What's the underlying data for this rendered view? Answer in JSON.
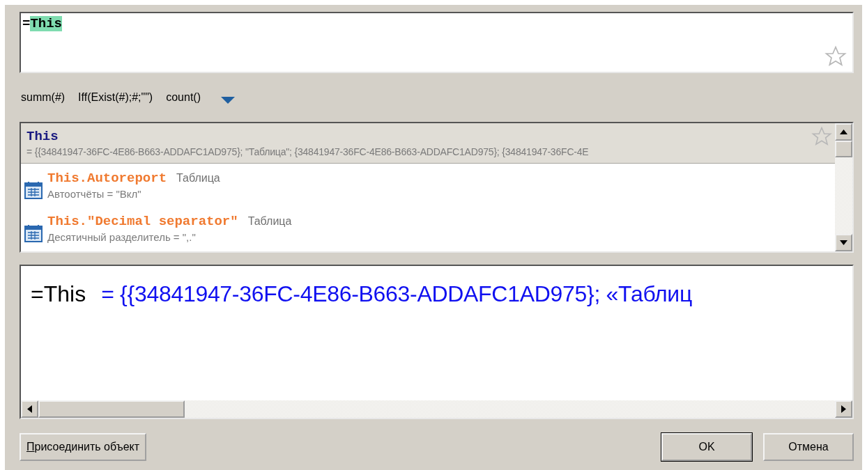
{
  "editor": {
    "prefix": "=",
    "value": "This"
  },
  "quick_functions": [
    "summ(#)",
    "Iff(Exist(#);#;\"\")",
    "count()"
  ],
  "suggestions": [
    {
      "name": "This",
      "description": "= {{34841947-36FC-4E86-B663-ADDAFC1AD975}; \"Таблица\"; {34841947-36FC-4E86-B663-ADDAFC1AD975}; {34841947-36FC-4E",
      "selected": true
    },
    {
      "name": "This.Autoreport",
      "type": "Таблица",
      "description": "Автоотчёты = \"Вкл\"",
      "selected": false
    },
    {
      "name": "This.\"Decimal separator\"",
      "type": "Таблица",
      "description": "Десятичный разделитель = \",.\"",
      "selected": false
    }
  ],
  "preview": {
    "expression": "=This",
    "result": "= {{34841947-36FC-4E86-B663-ADDAFC1AD975}; «Таблиц"
  },
  "buttons": {
    "attach": "Присоединить объект",
    "ok": "OK",
    "cancel": "Отмена"
  }
}
